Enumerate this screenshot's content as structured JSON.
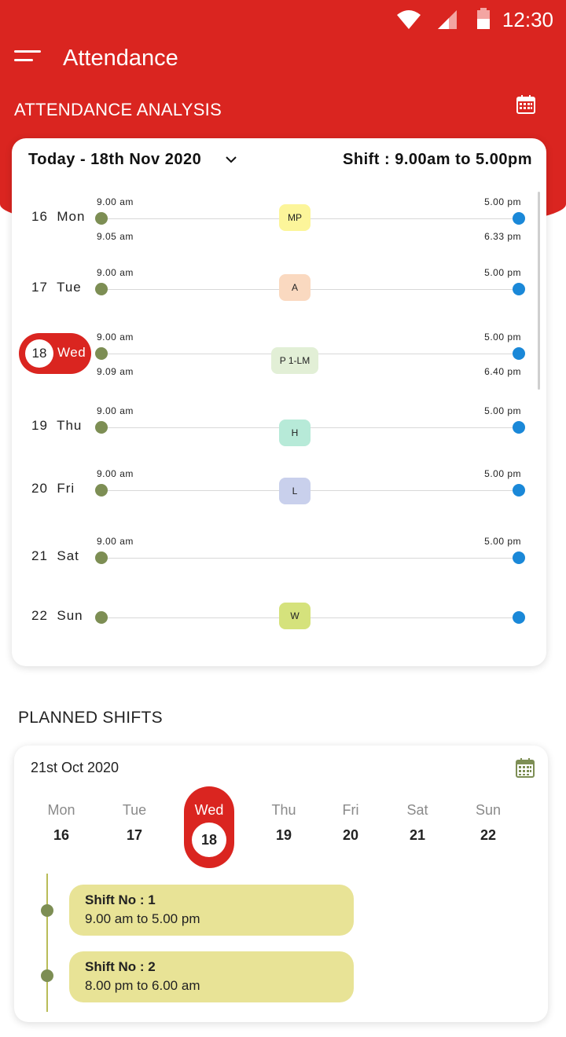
{
  "status_bar": {
    "time": "12:30"
  },
  "app_bar": {
    "title": "Attendance"
  },
  "attendance": {
    "section_title": "ATTENDANCE ANALYSIS",
    "date_selector": "Today - 18th Nov 2020",
    "shift_label": "Shift : 9.00am to 5.00pm",
    "rows": [
      {
        "date": "16",
        "day": "Mon",
        "sched_in": "9.00 am",
        "sched_out": "5.00 pm",
        "act_in": "9.05 am",
        "act_out": "6.33 pm",
        "status": "MP",
        "status_color": "#fcf59a"
      },
      {
        "date": "17",
        "day": "Tue",
        "sched_in": "9.00 am",
        "sched_out": "5.00 pm",
        "act_in": "",
        "act_out": "",
        "status": "A",
        "status_color": "#fad9c0"
      },
      {
        "date": "18",
        "day": "Wed",
        "sched_in": "9.00 am",
        "sched_out": "5.00 pm",
        "act_in": "9.09 am",
        "act_out": "6.40 pm",
        "status": "P 1-LM",
        "status_color": "#e2efd6"
      },
      {
        "date": "19",
        "day": "Thu",
        "sched_in": "9.00 am",
        "sched_out": "5.00 pm",
        "act_in": "",
        "act_out": "",
        "status": "H",
        "status_color": "#b7ead8"
      },
      {
        "date": "20",
        "day": "Fri",
        "sched_in": "9.00 am",
        "sched_out": "5.00 pm",
        "act_in": "",
        "act_out": "",
        "status": "L",
        "status_color": "#c9d0ec"
      },
      {
        "date": "21",
        "day": "Sat",
        "sched_in": "9.00 am",
        "sched_out": "5.00 pm",
        "act_in": "",
        "act_out": "",
        "status": "",
        "status_color": ""
      },
      {
        "date": "22",
        "day": "Sun",
        "sched_in": "",
        "sched_out": "",
        "act_in": "",
        "act_out": "",
        "status": "W",
        "status_color": "#d5e27c"
      }
    ]
  },
  "planned_shifts": {
    "section_title": "PLANNED SHIFTS",
    "date": "21st Oct 2020",
    "week": [
      {
        "name": "Mon",
        "num": "16"
      },
      {
        "name": "Tue",
        "num": "17"
      },
      {
        "name": "Wed",
        "num": "18"
      },
      {
        "name": "Thu",
        "num": "19"
      },
      {
        "name": "Fri",
        "num": "20"
      },
      {
        "name": "Sat",
        "num": "21"
      },
      {
        "name": "Sun",
        "num": "22"
      }
    ],
    "shifts": [
      {
        "title": "Shift No : 1",
        "time": "9.00 am to 5.00 pm"
      },
      {
        "title": "Shift No : 2",
        "time": "8.00 pm to 6.00 am"
      }
    ]
  },
  "colors": {
    "brand_red": "#da2520",
    "in_dot": "#7d8e54",
    "out_dot": "#1a88d8",
    "shift_box": "#e8e396"
  },
  "icons": {
    "menu": "menu-icon",
    "calendar": "calendar-icon",
    "chevron": "chevron-down-icon",
    "wifi": "wifi-icon",
    "signal": "signal-icon",
    "battery": "battery-icon"
  }
}
